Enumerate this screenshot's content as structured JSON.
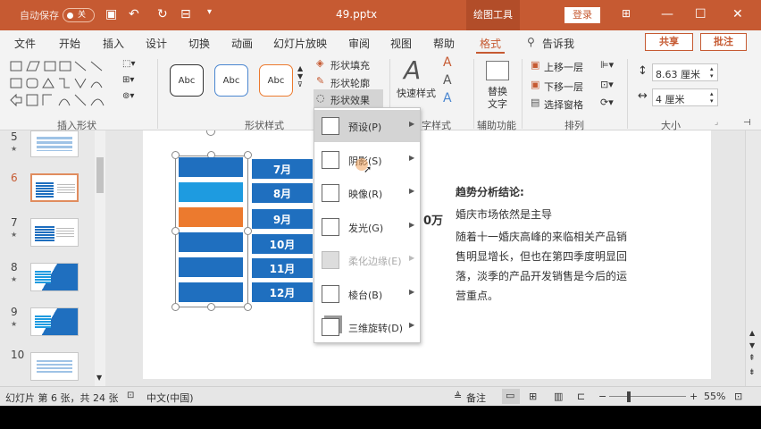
{
  "titlebar": {
    "autosave_label": "自动保存",
    "autosave_state": "关",
    "filename": "49.pptx",
    "context_tab": "绘图工具",
    "login_label": "登录"
  },
  "tabs": [
    "文件",
    "开始",
    "插入",
    "设计",
    "切换",
    "动画",
    "幻灯片放映",
    "审阅",
    "视图",
    "帮助",
    "格式"
  ],
  "tell_me": "告诉我",
  "share_label": "共享",
  "comment_label": "批注",
  "ribbon": {
    "groups": {
      "insert_shapes": "插入形状",
      "shape_styles": "形状样式",
      "wordart": "字样式",
      "accessibility": "辅助功能",
      "arrange": "排列",
      "size": "大小"
    },
    "style_presets": [
      "Abc",
      "Abc",
      "Abc"
    ],
    "shape_fill": "形状填充",
    "shape_outline": "形状轮廓",
    "shape_effects": "形状效果",
    "quick_styles": "快速样式",
    "alt_text_line1": "替换",
    "alt_text_line2": "文字",
    "bring_forward": "上移一层",
    "send_backward": "下移一层",
    "selection_pane": "选择窗格",
    "height": "8.63 厘米",
    "width": "4 厘米"
  },
  "thumbnails": [
    {
      "num": "5",
      "star": "★"
    },
    {
      "num": "6",
      "star": ""
    },
    {
      "num": "7",
      "star": "★"
    },
    {
      "num": "8",
      "star": "★"
    },
    {
      "num": "9",
      "star": "★"
    },
    {
      "num": "10",
      "star": ""
    }
  ],
  "slide": {
    "months": [
      "7月",
      "8月",
      "9月",
      "10月",
      "11月",
      "12月"
    ],
    "bar_colors": [
      "#1f6fbf",
      "#1e9be0",
      "#ec7a2e",
      "#1f6fbf",
      "#1f6fbf",
      "#1f6fbf"
    ],
    "partial_value": "0万",
    "conclusion_title": "趋势分析结论:",
    "conclusion_lines": [
      "婚庆市场依然是主导",
      "随着十一婚庆高峰的来临相关产品销",
      "售明显增长，但也在第四季度明显回",
      "落，淡季的产品开发销售是今后的运",
      "营重点。"
    ]
  },
  "effects_menu": [
    {
      "label": "预设(P)",
      "state": "hover"
    },
    {
      "label": "阴影(S)",
      "state": "normal"
    },
    {
      "label": "映像(R)",
      "state": "normal"
    },
    {
      "label": "发光(G)",
      "state": "normal"
    },
    {
      "label": "柔化边缘(E)",
      "state": "disabled"
    },
    {
      "label": "棱台(B)",
      "state": "normal"
    },
    {
      "label": "三维旋转(D)",
      "state": "normal"
    }
  ],
  "statusbar": {
    "slide_info": "幻灯片 第 6 张，共 24 张",
    "language": "中文(中国)",
    "notes": "备注",
    "zoom": "55%"
  },
  "colors": {
    "accent": "#c65a32",
    "blue": "#1f6fbf",
    "orange": "#ec7a2e"
  }
}
